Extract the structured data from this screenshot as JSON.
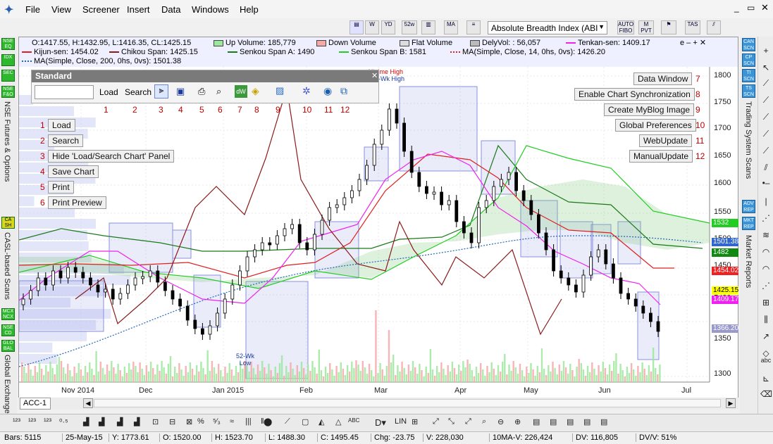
{
  "menubar": {
    "items": [
      "File",
      "View",
      "Screener",
      "Insert",
      "Data",
      "Windows",
      "Help"
    ],
    "indicator_select": "Absolute Breadth Index (ABI"
  },
  "toolbar_top": {
    "buttons": [
      "AUTO FIBO",
      "M PVT",
      "TAS"
    ]
  },
  "left_panel": {
    "badges": [
      "NSE EQ",
      "IDX",
      "SEC",
      "NSE F&O",
      "CA SH",
      "MCX NCX",
      "NSE CD",
      "GLO BAL"
    ],
    "labels": [
      "NSE Futures & Options",
      "CASL-based Scans",
      "Global Exchanges"
    ]
  },
  "right_panel": {
    "badges": [
      "CAN SCN",
      "CP SCN",
      "TI SCN",
      "TS SCN",
      "ADV REP",
      "MKT REP"
    ],
    "labels": [
      "Trading System Scans",
      "Market Reports"
    ]
  },
  "chart": {
    "ohlc": "O:1417.55, H:1432.95, L:1416.35, CL:1425.15",
    "up_volume": "Up Volume: 185,779",
    "down_volume": "Down Volume",
    "flat_volume": "Flat Volume",
    "dely_vol": "DelyVol: : 56,057",
    "tenkan": "Tenkan-sen: 1409.17",
    "kijun": "Kijun-sen: 1454.02",
    "chikou": "Chikou Span: 1425.15",
    "senkou_a": "Senkou Span A: 1490",
    "senkou_b": "Senkou Span B: 1581",
    "ma14": "MA(Simple, Close, 14, 0hs, 0vs): 1426.20",
    "ma200": "MA(Simple, Close, 200, 0hs, 0vs): 1501.38",
    "win_controls": "e – + ✕",
    "alltime_high": "All-time High",
    "wk52_high": "52-Wk High",
    "wk52_low": "52-Wk Low",
    "y_ticks": [
      "1800",
      "1750",
      "1700",
      "1650",
      "1600",
      "1550",
      "1500",
      "1450",
      "1400",
      "1350",
      "1300"
    ],
    "x_ticks": [
      "Nov 2014",
      "Dec",
      "Jan 2015",
      "Feb",
      "Mar",
      "Apr",
      "May",
      "Jun",
      "Jul"
    ],
    "price_labels": [
      {
        "text": "1532",
        "bg": "#22cc22",
        "fg": "#fff"
      },
      {
        "text": "1501.38",
        "bg": "#3366cc",
        "fg": "#fff"
      },
      {
        "text": "1482",
        "bg": "#118811",
        "fg": "#fff"
      },
      {
        "text": "1454.02",
        "bg": "#ee2222",
        "fg": "#fff"
      },
      {
        "text": "1425.15",
        "bg": "#ffff00",
        "fg": "#000"
      },
      {
        "text": "1409.17",
        "bg": "#ee22ee",
        "fg": "#fff"
      },
      {
        "text": "1366.20",
        "bg": "#9999cc",
        "fg": "#fff"
      }
    ],
    "tab": "ACC-1"
  },
  "std_panel": {
    "title": "Standard",
    "load": "Load",
    "search": "Search",
    "numbers": [
      "1",
      "2",
      "3",
      "4",
      "5",
      "6",
      "7",
      "8",
      "9",
      "10",
      "11",
      "12"
    ]
  },
  "left_buttons": [
    {
      "num": "1",
      "label": "Load"
    },
    {
      "num": "2",
      "label": "Search"
    },
    {
      "num": "3",
      "label": "Hide 'Load/Search Chart' Panel"
    },
    {
      "num": "4",
      "label": "Save Chart"
    },
    {
      "num": "5",
      "label": "Print"
    },
    {
      "num": "6",
      "label": "Print Preview"
    }
  ],
  "right_buttons": [
    {
      "num": "7",
      "label": "Data Window"
    },
    {
      "num": "8",
      "label": "Enable Chart Synchronization"
    },
    {
      "num": "9",
      "label": "Create MyBlog Image"
    },
    {
      "num": "10",
      "label": "Global Preferences"
    },
    {
      "num": "11",
      "label": "WebUpdate"
    },
    {
      "num": "12",
      "label": "ManualUpdate"
    }
  ],
  "bottom_toolbar": {
    "items": [
      "LIN",
      "ABC"
    ]
  },
  "status": [
    "Bars: 5115",
    "25-May-15",
    "Y: 1773.61",
    "O: 1520.00",
    "H: 1523.70",
    "L: 1488.30",
    "C: 1495.45",
    "Chg: -23.75",
    "V: 228,030",
    "10MA-V: 226,424",
    "DV: 116,805",
    "DV/V: 51%"
  ]
}
